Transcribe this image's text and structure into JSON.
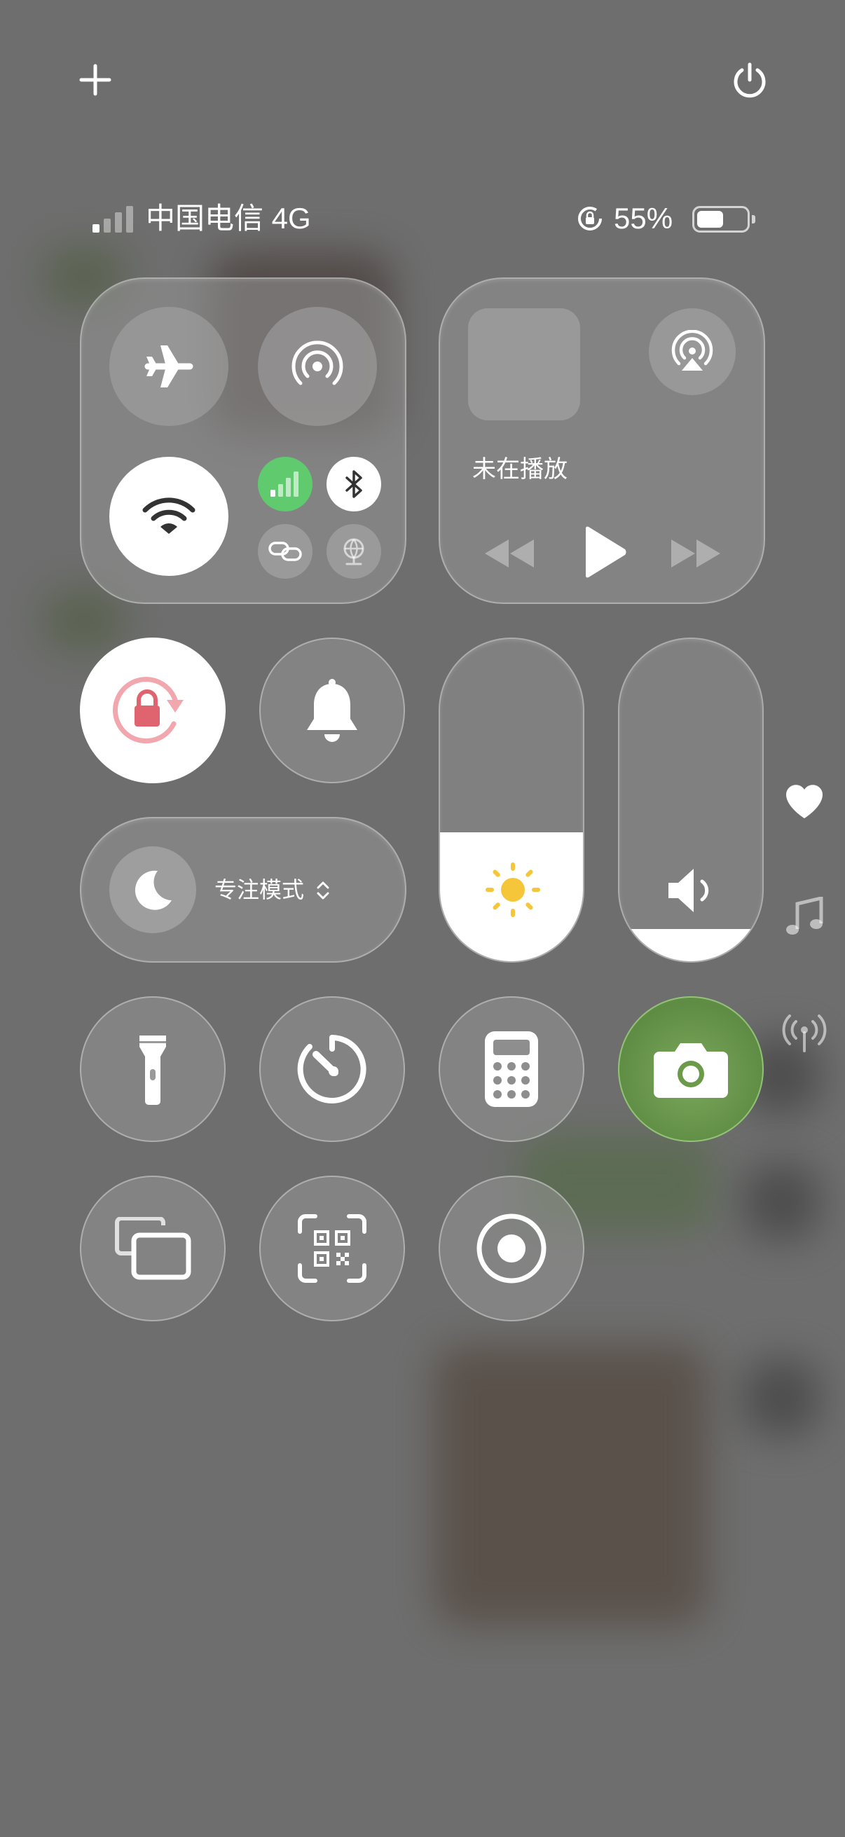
{
  "status_bar": {
    "carrier": "中国电信 4G",
    "battery_percent": "55%",
    "battery_level": 0.55
  },
  "media": {
    "now_playing": "未在播放"
  },
  "focus": {
    "label": "专注模式"
  },
  "sliders": {
    "brightness_level": 0.4,
    "volume_level": 0.1
  },
  "colors": {
    "cellular_active": "#5fcb6e",
    "camera_tint": "#6a9a4a",
    "lock_rotation": "#e06470",
    "sun": "#f5c63a"
  },
  "side_icons": [
    "heart-icon",
    "music-note-icon",
    "antenna-icon"
  ]
}
